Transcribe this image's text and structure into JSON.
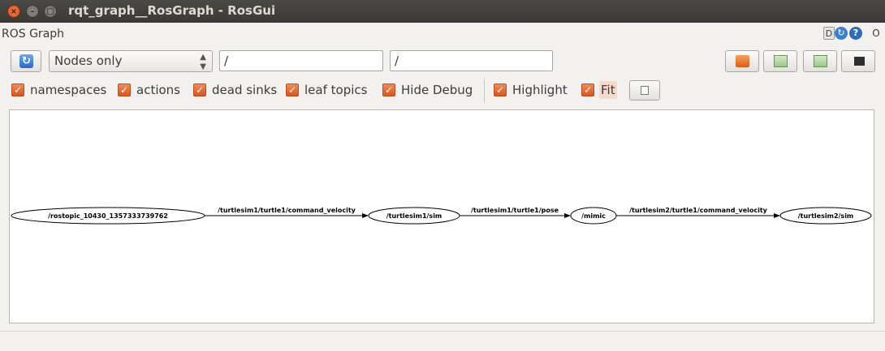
{
  "window": {
    "title": "rqt_graph__RosGraph - RosGui",
    "close_glyph": "×",
    "min_glyph": "–",
    "max_glyph": "□"
  },
  "dock": {
    "title": "ROS Graph",
    "d_label": "D",
    "reload_glyph": "↻",
    "help_label": "?",
    "o_label": "O"
  },
  "toolbar": {
    "refresh_glyph": "↻",
    "graph_type": "Nodes only",
    "ns_filter_value": "/",
    "topic_filter_value": "/"
  },
  "options": {
    "namespaces": "namespaces",
    "actions": "actions",
    "dead_sinks": "dead sinks",
    "leaf_topics": "leaf topics",
    "hide_debug": "Hide Debug",
    "highlight": "Highlight",
    "fit": "Fit",
    "check_glyph": "✓"
  },
  "graph": {
    "nodes": [
      "/rostopic_10430_1357333739762",
      "/turtlesim1/sim",
      "/mimic",
      "/turtlesim2/sim"
    ],
    "edges": [
      "/turtlesim1/turtle1/command_velocity",
      "/turtlesim1/turtle1/pose",
      "/turtlesim2/turtle1/command_velocity"
    ]
  },
  "colors": {
    "checkbox": "#d7561e",
    "titlebar": "#3b3a37",
    "accent_blue": "#2a67c4"
  }
}
